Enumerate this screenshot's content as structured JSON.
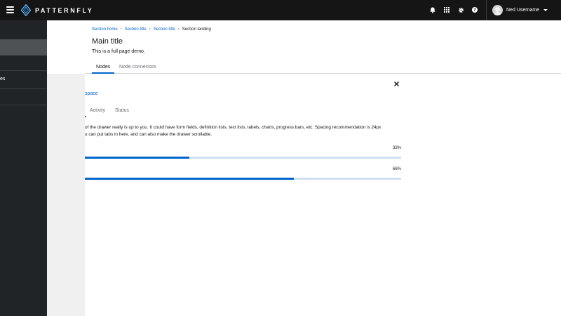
{
  "masthead": {
    "brand": "PATTERNFLY",
    "user_name": "Ned Username",
    "icons": [
      "bell-icon",
      "grid-icon",
      "gear-icon",
      "help-icon"
    ]
  },
  "sidebar": {
    "items": [
      {
        "label": "",
        "active": true
      },
      {
        "label": "es",
        "active": false
      },
      {
        "label": "",
        "active": false
      }
    ]
  },
  "breadcrumb": {
    "items": [
      "Section home",
      "Section title",
      "Section title"
    ],
    "current": "Section landing"
  },
  "page": {
    "title": "Main title",
    "subtitle": "This is a full page demo."
  },
  "tabs": [
    "Nodes",
    "Node connectors"
  ],
  "drawer": {
    "title": "space",
    "tabs": [
      "Activity",
      "Status"
    ],
    "body_line_1": "of the drawer really is up to you. It could have form fields, definition lists, text lists, labels, charts, progress bars, etc. Spacing recommendation is 24px",
    "body_line_2": "u can put tabs in here, and can also make the drawer scrollable.",
    "progress": [
      {
        "label": "33%",
        "value": 0.33
      },
      {
        "label": "66%",
        "value": 0.66
      }
    ]
  },
  "colors": {
    "masthead": "#151515",
    "sidebar": "#212427",
    "accent": "#0066cc",
    "progress_track": "#cfe0f2"
  }
}
